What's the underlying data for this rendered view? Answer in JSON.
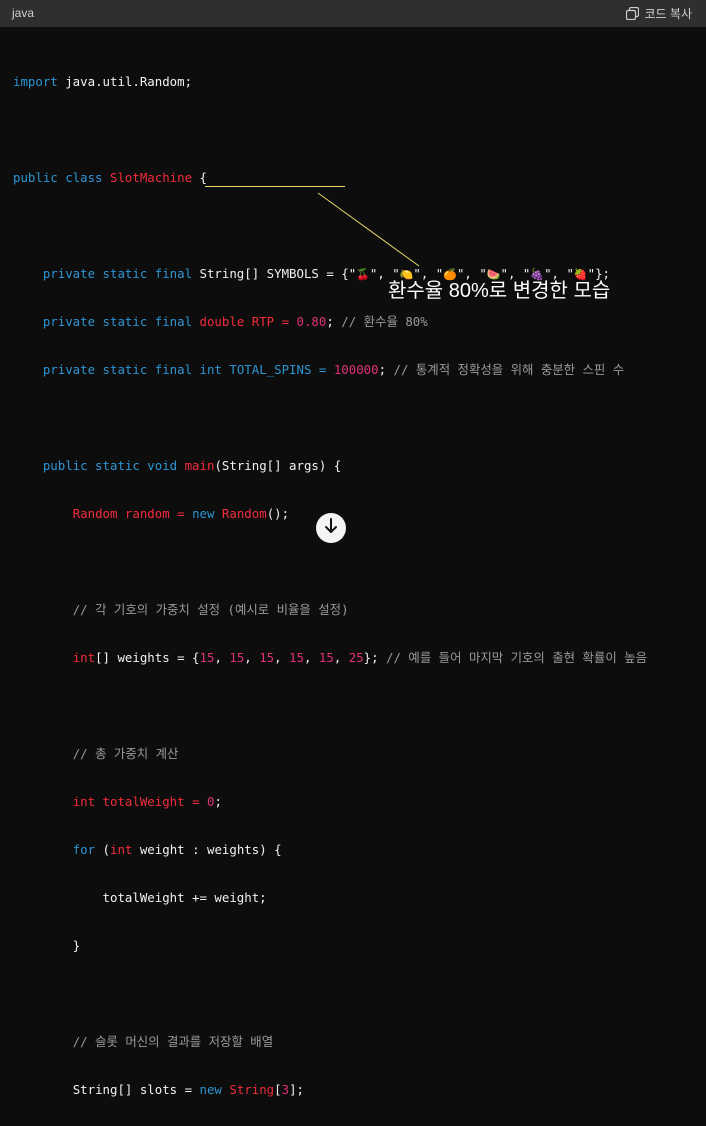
{
  "header": {
    "language": "java",
    "copy_label": "코드 복사"
  },
  "code": {
    "import_kw": "import",
    "import_rest": " java.util.Random;",
    "class_kw": "public class",
    "class_name": "SlotMachine",
    "class_brace": " {",
    "l1_kw": "private static final",
    "l1_rest": " String[] SYMBOLS = {\"",
    "sym1": "🍒",
    "sym2": "🍋",
    "sym3": "🍊",
    "sym4": "🍉",
    "sym5": "🍇",
    "sym6": "🍓",
    "sep": "\", \"",
    "l1_end": "\"};",
    "l2_kw": "private static final",
    "l2_type": "double",
    "l2_name": " RTP = ",
    "l2_num": "0.80",
    "l2_semi": ";",
    "l2_comment": "// 환수율 80%",
    "l3_kw": "private static final",
    "l3_type": "int",
    "l3_name": " TOTAL_SPINS = ",
    "l3_num": "100000",
    "l3_semi": ";",
    "l3_comment": "// 통계적 정확성을 위해 충분한 스핀 수",
    "main_kw": "public static void",
    "main_name": "main",
    "main_rest": "(String[] args) {",
    "rand_type": "Random",
    "rand_var": " random = ",
    "rand_new": "new",
    "rand_ctor": "Random",
    "rand_end": "();",
    "c1": "// 각 기호의 가중치 설정 (예시로 비율을 설정)",
    "w_type": "int",
    "w_rest": "[] weights = {",
    "w_vals": [
      "15",
      "15",
      "15",
      "15",
      "15",
      "25"
    ],
    "w_end": "};",
    "w_comment": "// 예를 들어 마지막 기호의 출현 확률이 높음",
    "c2": "// 총 가중치 계산",
    "tw_type": "int",
    "tw_name": "totalWeight",
    "tw_eq": " = ",
    "tw_num": "0",
    "tw_semi": ";",
    "for_kw": "for",
    "for_open": " (",
    "for_type": "int",
    "for_rest": " weight : weights) {",
    "sum_line": "totalWeight += weight;",
    "close_brace": "}",
    "c3": "// 슬롯 머신의 결과를 저장할 배열",
    "s_type": "String[] slots = ",
    "s_new": "new",
    "s_ctor": "String",
    "s_open": "[",
    "s_num": "3",
    "s_end": "];"
  },
  "annotation": {
    "text": "환수율 80%로 변경한 모습"
  },
  "icons": {
    "copy": "copy-icon",
    "scroll_down": "arrow-down-icon"
  }
}
